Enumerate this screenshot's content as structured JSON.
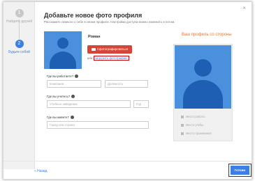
{
  "sidebar": {
    "steps": [
      {
        "number": "1",
        "label": "Найдите друзей"
      },
      {
        "number": "2",
        "label": "Будьте собой"
      }
    ]
  },
  "header": {
    "title": "Добавьте новое фото профиля",
    "subtitle": "Расскажите немного о себе в своем профиле. Настройки доступа можно изменить и потом.",
    "close": "×"
  },
  "profile": {
    "name": "Роман",
    "photo_button": "Сфотографироваться",
    "upload_prefix": "или",
    "upload_link": "загрузить фотографию"
  },
  "form": {
    "work": {
      "label": "Где вы работаете?",
      "company_placeholder": "Компания",
      "position_placeholder": "Должность"
    },
    "study": {
      "label": "Где вы учитесь?",
      "school_placeholder": "Учебное заведение",
      "year_placeholder": "Год"
    },
    "live": {
      "label": "Где вы живете?",
      "city_placeholder": "Город или страна"
    }
  },
  "preview": {
    "title": "Ваш профиль со стороны",
    "items": [
      "Место работы",
      "Место учебы",
      "Место проживания"
    ]
  },
  "footer": {
    "back": "« Назад",
    "done": "Готово"
  },
  "colors": {
    "accent": "#3c7ee4",
    "photo_button": "#d44638",
    "highlight": "#cc0000",
    "preview_title": "#dd7a3a"
  }
}
